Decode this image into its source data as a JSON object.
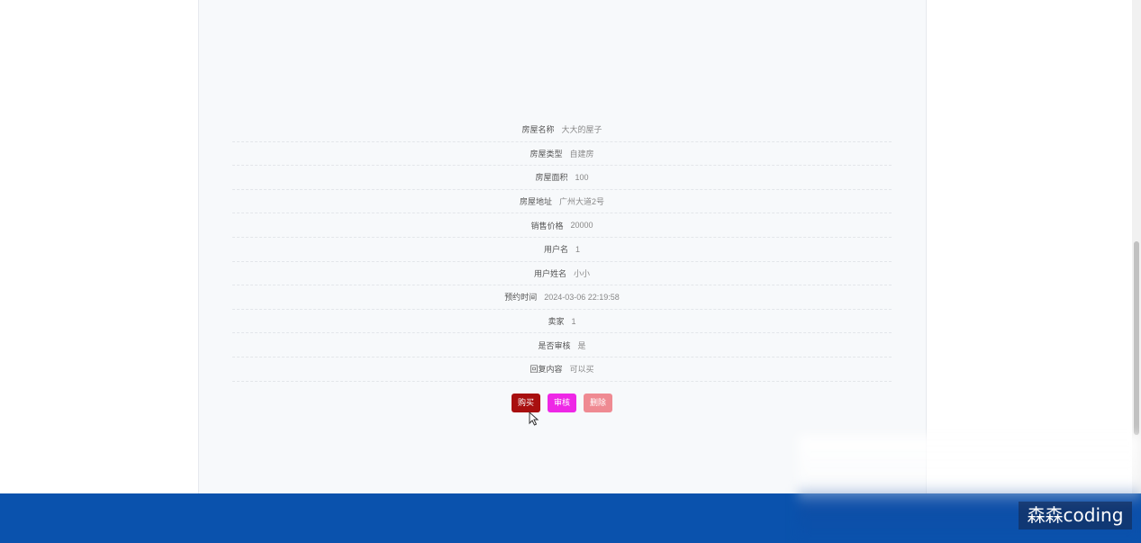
{
  "details": [
    {
      "label": "房屋名称",
      "value": "大大的屋子"
    },
    {
      "label": "房屋类型",
      "value": "自建房"
    },
    {
      "label": "房屋面积",
      "value": "100"
    },
    {
      "label": "房屋地址",
      "value": "广州大道2号"
    },
    {
      "label": "销售价格",
      "value": "20000"
    },
    {
      "label": "用户名",
      "value": "1"
    },
    {
      "label": "用户姓名",
      "value": "小小"
    },
    {
      "label": "预约时间",
      "value": "2024-03-06 22:19:58"
    },
    {
      "label": "卖家",
      "value": "1"
    },
    {
      "label": "是否审核",
      "value": "是"
    },
    {
      "label": "回复内容",
      "value": "可以买"
    }
  ],
  "actions": {
    "buy_label": "购买",
    "audit_label": "审核",
    "delete_label": "删除"
  },
  "watermark": {
    "text": "森森coding"
  },
  "colors": {
    "footer": "#0a52ad",
    "buy": "#a80f0f",
    "audit": "#ee27e6",
    "delete": "#ef8a92"
  },
  "icons": {
    "cursor": "arrow-cursor-icon"
  }
}
